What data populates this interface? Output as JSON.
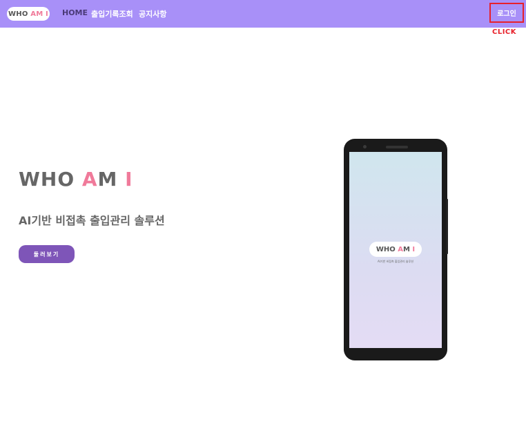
{
  "nav": {
    "logo": {
      "who": "WHO",
      "a": "A",
      "m": "M",
      "i": "I"
    },
    "links": {
      "home": "HOME",
      "records": "출입기록조회",
      "notice": "공지사항"
    },
    "login_label": "로그인",
    "click_note": "CLICK"
  },
  "hero": {
    "title": {
      "who": "WHO",
      "a": "A",
      "m": "M",
      "i": "I"
    },
    "subtitle": "AI기반 비접촉 출입관리 솔루션",
    "more_button": "둘러보기"
  },
  "phone": {
    "logo": {
      "who": "WHO",
      "a": "A",
      "m": "M",
      "i": "I"
    },
    "subtitle": "AI기반 비접촉 출입관리 솔루션"
  },
  "colors": {
    "nav_bg": "#a890f8",
    "accent_pink": "#f07a9a",
    "button_purple": "#7e55b8",
    "highlight_red": "#e8202a"
  }
}
